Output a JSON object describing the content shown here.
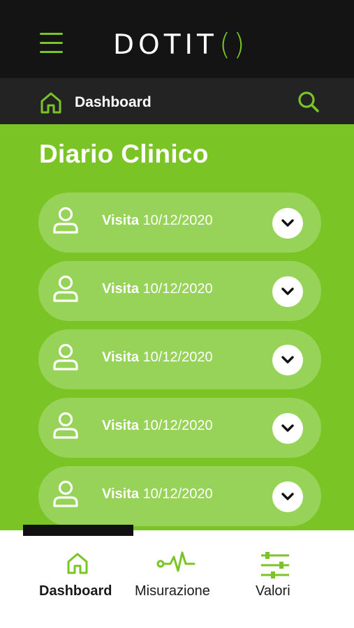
{
  "app": {
    "logo_text": "DOTIT",
    "logo_brackets": "()",
    "accent_color": "#7ac426",
    "dark_color": "#141414"
  },
  "header": {
    "menu_icon": "hamburger-menu-icon",
    "breadcrumb": "Dashboard",
    "breadcrumb_icon": "home-icon",
    "search_icon": "search-icon"
  },
  "main": {
    "title": "Diario Clinico",
    "visits": [
      {
        "prefix": "Visita",
        "date": "10/12/2020",
        "icon": "user-icon",
        "toggle_icon": "chevron-down-icon"
      },
      {
        "prefix": "Visita",
        "date": "10/12/2020",
        "icon": "user-icon",
        "toggle_icon": "chevron-down-icon"
      },
      {
        "prefix": "Visita",
        "date": "10/12/2020",
        "icon": "user-icon",
        "toggle_icon": "chevron-down-icon"
      },
      {
        "prefix": "Visita",
        "date": "10/12/2020",
        "icon": "user-icon",
        "toggle_icon": "chevron-down-icon"
      },
      {
        "prefix": "Visita",
        "date": "10/12/2020",
        "icon": "user-icon",
        "toggle_icon": "chevron-down-icon"
      }
    ]
  },
  "bottom_nav": {
    "items": [
      {
        "label": "Dashboard",
        "icon": "home-icon",
        "active": true
      },
      {
        "label": "Misurazione",
        "icon": "heartbeat-icon",
        "active": false
      },
      {
        "label": "Valori",
        "icon": "sliders-icon",
        "active": false
      }
    ]
  }
}
